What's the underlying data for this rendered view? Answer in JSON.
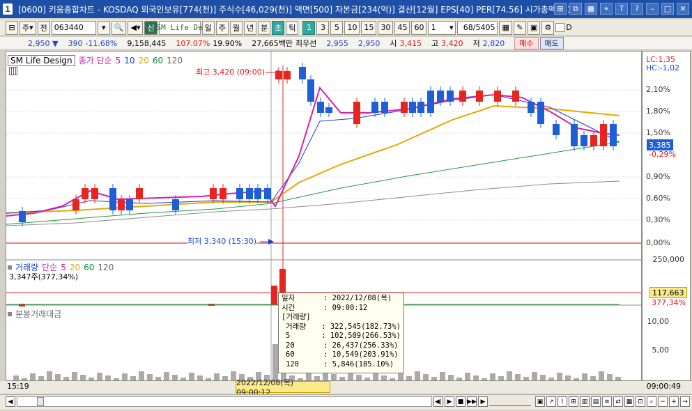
{
  "window": {
    "app_num": "1",
    "title": "[0600] 키움종합차트 - KOSDAQ 외국인보유[774(천)] 주식수[46,029(천)] 액면[500] 자본금[234(억)] 결산[12월] EPS[40] PER[74.56] 시가총액[1,3"
  },
  "toolbar": {
    "mode": "주",
    "type": "전",
    "code": "063440",
    "name": "SM Life De",
    "periods": [
      "일",
      "주",
      "월",
      "년",
      "분",
      "초",
      "틱"
    ],
    "selected_period": "초",
    "intervals": [
      "1",
      "3",
      "5",
      "10",
      "15",
      "30",
      "45",
      "60"
    ],
    "selected_interval": "1",
    "count": "1",
    "page": "68/5405",
    "d_label": "D"
  },
  "quote": {
    "price": "2,950 ▼",
    "change": "390",
    "change_pct": "-11.68%",
    "volume": "9,158,445",
    "vol_ratio": "107.07%",
    "turnover": "19.90%",
    "amount": "27,665백만",
    "best_label": "최우선",
    "best_ask": "2,955",
    "best_bid": "2,950",
    "open_label": "시",
    "open": "3,415",
    "high_label": "고",
    "high": "3,420",
    "low_label": "저",
    "low": "2,820",
    "buy": "매수",
    "sell": "매도"
  },
  "price_panel": {
    "name": "SM Life Design",
    "ma_label": "종가 단순",
    "ma": [
      "5",
      "10",
      "20",
      "60",
      "120"
    ],
    "high_note": "최고 3,420 (09:00)",
    "low_note": "최저 3,340 (15:30)",
    "y_ticks": [
      "2,10%",
      "1,80%",
      "1,50%",
      "0,90%",
      "0,60%",
      "0,30%",
      "0,00%"
    ],
    "lc": "LC:1,35",
    "hc": "HC:-1,02",
    "cur_price": "3,385",
    "cur_pct": "-0,29%"
  },
  "volume_panel": {
    "label": "거래량",
    "ma_label": "단순",
    "ma": [
      "5",
      "20",
      "60",
      "120"
    ],
    "current": "3,347주(377,34%)",
    "y_top": "250,000",
    "marker": "117,663",
    "marker_pct": "377,34%"
  },
  "amount_panel": {
    "label": "분봉거래대금",
    "y_ticks": [
      "10,00",
      "5,00"
    ]
  },
  "tooltip": {
    "date_label": "일자",
    "date": "2022/12/08(목)",
    "time_label": "시간",
    "time": "09:00:12",
    "section": "[거래량]",
    "rows": [
      {
        "k": "거래량",
        "v": "322,545(182.73%)"
      },
      {
        "k": "5",
        "v": "102,509(266.53%)"
      },
      {
        "k": "20",
        "v": "26,437(256.33%)"
      },
      {
        "k": "60",
        "v": "10,549(203.91%)"
      },
      {
        "k": "120",
        "v": "5,846(185.10%)"
      }
    ]
  },
  "bottom": {
    "left_time": "15:19",
    "cursor_time": "2022/12/08(목) 09:00:12",
    "right_time": "09:00:49"
  },
  "colors": {
    "up": "#e8241f",
    "down": "#1f5fd6",
    "ma5": "#d91fa8",
    "ma10": "#1a3ad8",
    "ma20": "#e9a800",
    "ma60": "#1f9a3f",
    "ma120": "#8b8b8b"
  }
}
